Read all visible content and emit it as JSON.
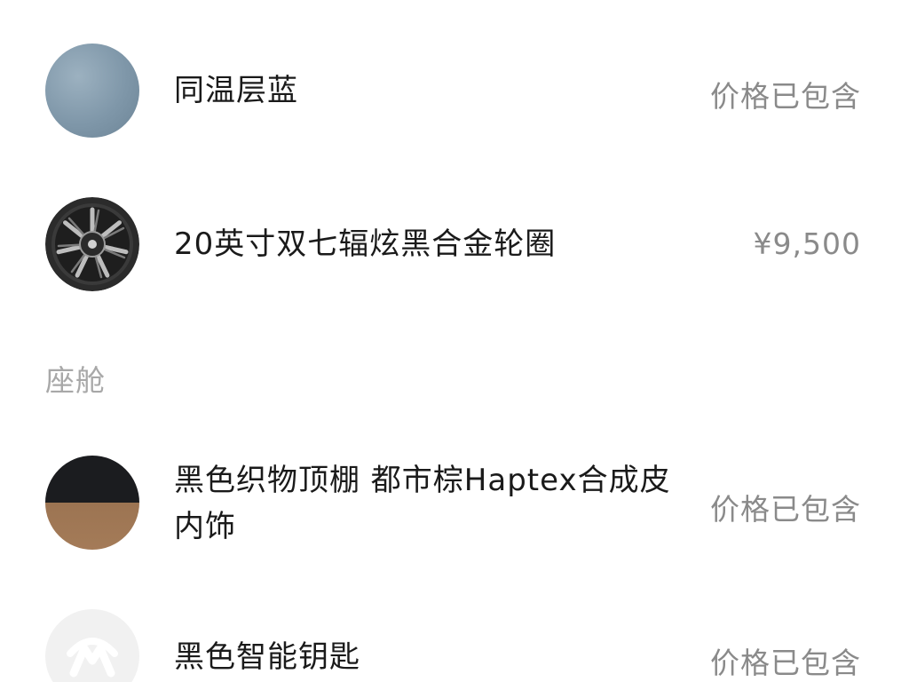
{
  "items": [
    {
      "name": "同温层蓝",
      "price": "价格已包含",
      "icon": "color-swatch-blue"
    },
    {
      "name": "20英寸双七辐炫黑合金轮圈",
      "price": "¥9,500",
      "icon": "wheel-icon"
    }
  ],
  "section": {
    "title": "座舱"
  },
  "cabin_items": [
    {
      "name_line1": "黑色织物顶棚 都市棕Haptex合成皮",
      "name_line2": "内饰",
      "price": "价格已包含",
      "icon": "interior-swatch"
    },
    {
      "name": "黑色智能钥匙",
      "price": "价格已包含",
      "icon": "key-icon"
    }
  ],
  "colors": {
    "text_primary": "#1a1a1a",
    "text_secondary": "#8a8a8a",
    "section_label": "#a8a8a8"
  }
}
